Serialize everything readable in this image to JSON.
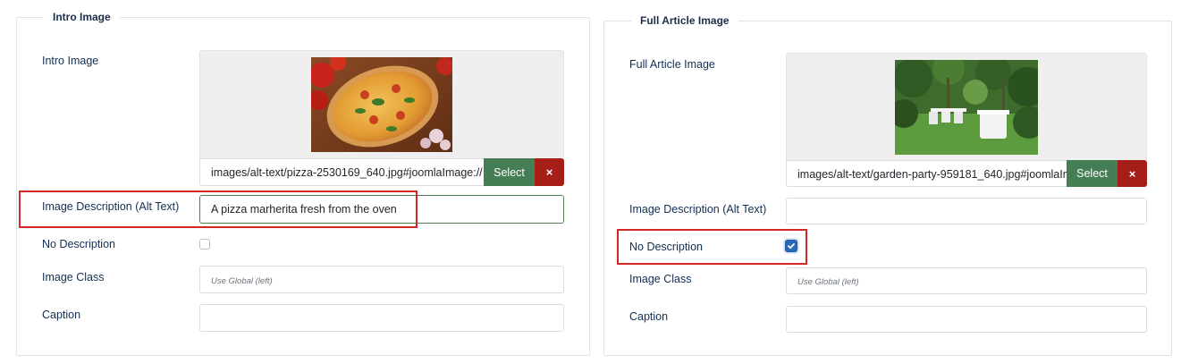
{
  "intro": {
    "legend": "Intro Image",
    "image_label": "Intro Image",
    "image_path": "images/alt-text/pizza-2530169_640.jpg#joomlaImage://",
    "image_icon": "pizza-image",
    "select_label": "Select",
    "clear_label": "×",
    "alt_label": "Image Description (Alt Text)",
    "alt_value": "A pizza marherita fresh from the oven",
    "no_desc_label": "No Description",
    "no_desc_checked": false,
    "class_label": "Image Class",
    "class_placeholder": "Use Global (left)",
    "caption_label": "Caption",
    "caption_value": ""
  },
  "full": {
    "legend": "Full Article Image",
    "image_label": "Full Article Image",
    "image_path": "images/alt-text/garden-party-959181_640.jpg#joomlaIm",
    "image_icon": "garden-party-image",
    "select_label": "Select",
    "clear_label": "×",
    "alt_label": "Image Description (Alt Text)",
    "alt_value": "",
    "no_desc_label": "No Description",
    "no_desc_checked": true,
    "class_label": "Image Class",
    "class_placeholder": "Use Global (left)",
    "caption_label": "Caption",
    "caption_value": ""
  },
  "colors": {
    "select_button": "#457d54",
    "clear_button": "#a51f18",
    "highlight": "#d22828",
    "checkbox_checked": "#2a69b8"
  }
}
